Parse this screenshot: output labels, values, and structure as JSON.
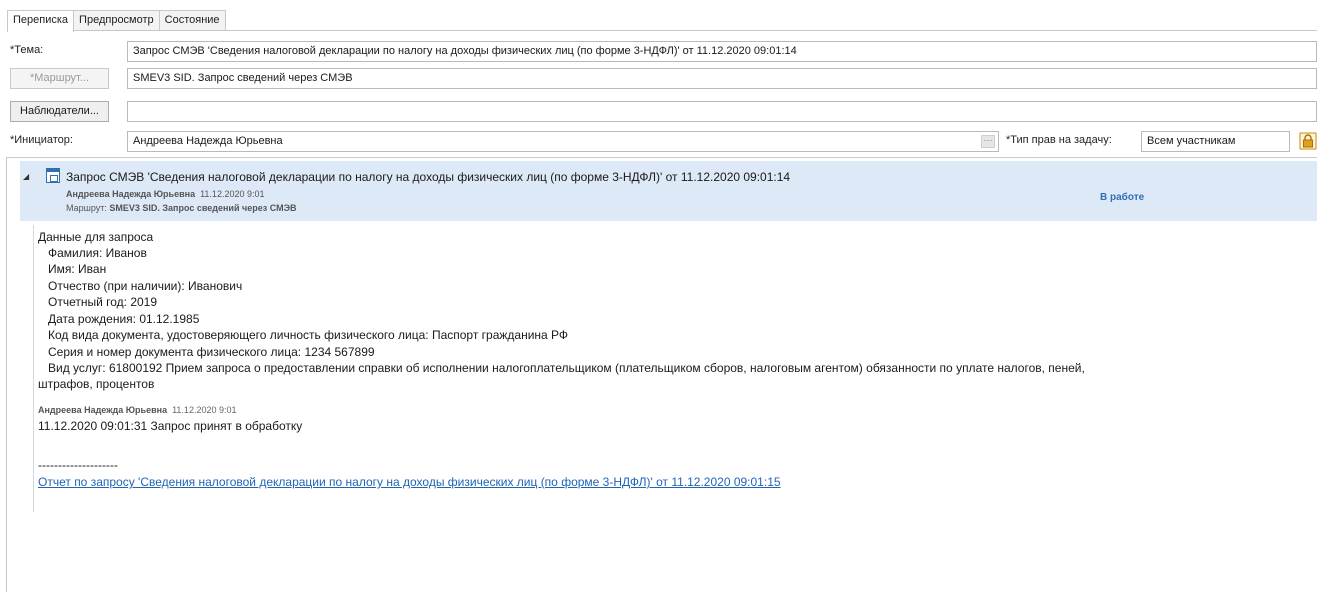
{
  "tabs": [
    {
      "label": "Переписка"
    },
    {
      "label": "Предпросмотр"
    },
    {
      "label": "Состояние"
    }
  ],
  "form": {
    "subject_label": "*Тема:",
    "subject_value": "Запрос СМЭВ 'Сведения налоговой декларации по налогу на доходы физических лиц (по форме 3-НДФЛ)' от 11.12.2020 09:01:14",
    "route_button": "*Маршрут...",
    "route_value": "SMEV3 SID. Запрос сведений через СМЭВ",
    "observers_button": "Наблюдатели...",
    "observers_value": "",
    "initiator_label": "*Инициатор:",
    "initiator_value": "Андреева Надежда Юрьевна",
    "dots": "···",
    "rights_label": "*Тип прав на задачу:",
    "rights_value": "Всем участникам"
  },
  "message": {
    "title": "Запрос СМЭВ 'Сведения налоговой декларации по налогу на доходы физических лиц (по форме 3-НДФЛ)' от 11.12.2020 09:01:14",
    "author": "Андреева Надежда Юрьевна",
    "date": "11.12.2020 9:01",
    "route_label": "Маршрут:",
    "route_value": "SMEV3 SID. Запрос сведений через СМЭВ",
    "status": "В работе",
    "collapse_glyph": "◢",
    "lines": [
      "Данные для запроса",
      "Фамилия: Иванов",
      "Имя: Иван",
      "Отчество (при наличии): Иванович",
      "Отчетный год: 2019",
      "Дата рождения: 01.12.1985",
      "Код вида документа, удостоверяющего личность физического лица: Паспорт гражданина РФ",
      "Серия и номер документа физического лица: 1234 567899",
      "Вид услуг: 61800192 Прием запроса о предоставлении справки об исполнении налогоплательщиком (плательщиком сборов, налоговым агентом) обязанности по уплате налогов, пеней,",
      "штрафов, процентов"
    ],
    "reply_author": "Андреева Надежда Юрьевна",
    "reply_date": "11.12.2020 9:01",
    "reply_text": "11.12.2020 09:01:31 Запрос принят в обработку",
    "separator": "--------------------",
    "report_link": "Отчет по запросу 'Сведения налоговой декларации по налогу на доходы физических лиц (по форме 3-НДФЛ)' от 11.12.2020 09:01:15"
  },
  "colors": {
    "header_bg": "#dde9f6",
    "status": "#2e6fb6",
    "link": "#1f64b5",
    "lock": "#e0a020"
  },
  "icons": {
    "message": "calendar-icon",
    "lock": "lock-icon"
  }
}
